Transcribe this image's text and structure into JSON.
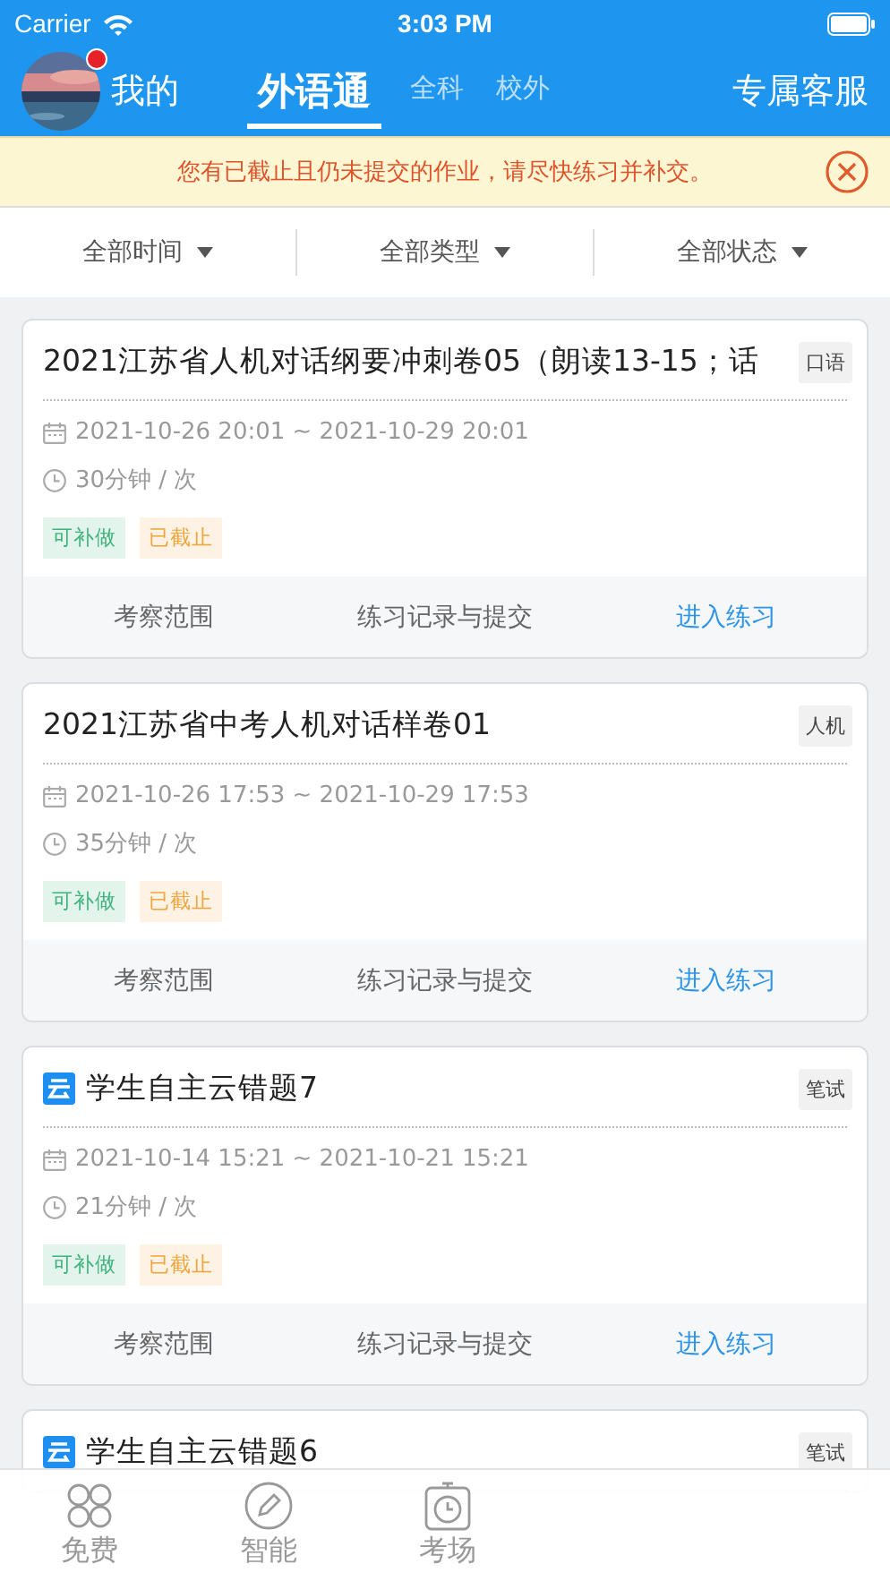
{
  "status_bar": {
    "carrier": "Carrier",
    "time": "3:03 PM"
  },
  "header": {
    "profile_label": "我的",
    "has_notification": true,
    "tabs": [
      {
        "label": "外语通",
        "selected": true
      },
      {
        "label": "全科",
        "selected": false
      },
      {
        "label": "校外",
        "selected": false
      }
    ],
    "service_label": "专属客服"
  },
  "notice": {
    "text": "您有已截止且仍未提交的作业，请尽快练习并补交。"
  },
  "filters": [
    {
      "label": "全部时间"
    },
    {
      "label": "全部类型"
    },
    {
      "label": "全部状态"
    }
  ],
  "cards": [
    {
      "cloud_icon": false,
      "title": "2021江苏省人机对话纲要冲刺卷05（朗读13-15；话",
      "badge": "口语",
      "date": "2021-10-26 20:01 ~ 2021-10-29 20:01",
      "duration": "30分钟 / 次",
      "tags": [
        {
          "label": "可补做",
          "kind": "green"
        },
        {
          "label": "已截止",
          "kind": "orange"
        }
      ],
      "actions": [
        {
          "label": "考察范围",
          "primary": false
        },
        {
          "label": "练习记录与提交",
          "primary": false
        },
        {
          "label": "进入练习",
          "primary": true
        }
      ]
    },
    {
      "cloud_icon": false,
      "title": "2021江苏省中考人机对话样卷01",
      "badge": "人机",
      "date": "2021-10-26 17:53 ~ 2021-10-29 17:53",
      "duration": "35分钟 / 次",
      "tags": [
        {
          "label": "可补做",
          "kind": "green"
        },
        {
          "label": "已截止",
          "kind": "orange"
        }
      ],
      "actions": [
        {
          "label": "考察范围",
          "primary": false
        },
        {
          "label": "练习记录与提交",
          "primary": false
        },
        {
          "label": "进入练习",
          "primary": true
        }
      ]
    },
    {
      "cloud_icon": true,
      "title": "学生自主云错题7",
      "badge": "笔试",
      "date": "2021-10-14 15:21 ~ 2021-10-21 15:21",
      "duration": "21分钟 / 次",
      "tags": [
        {
          "label": "可补做",
          "kind": "green"
        },
        {
          "label": "已截止",
          "kind": "orange"
        }
      ],
      "actions": [
        {
          "label": "考察范围",
          "primary": false
        },
        {
          "label": "练习记录与提交",
          "primary": false
        },
        {
          "label": "进入练习",
          "primary": true
        }
      ]
    },
    {
      "cloud_icon": true,
      "title": "学生自主云错题6",
      "badge": "笔试"
    }
  ],
  "tab_bar": [
    {
      "label": "免费",
      "kind": "grid"
    },
    {
      "label": "智能",
      "kind": "pen"
    },
    {
      "label": "考场",
      "kind": "clock"
    }
  ]
}
